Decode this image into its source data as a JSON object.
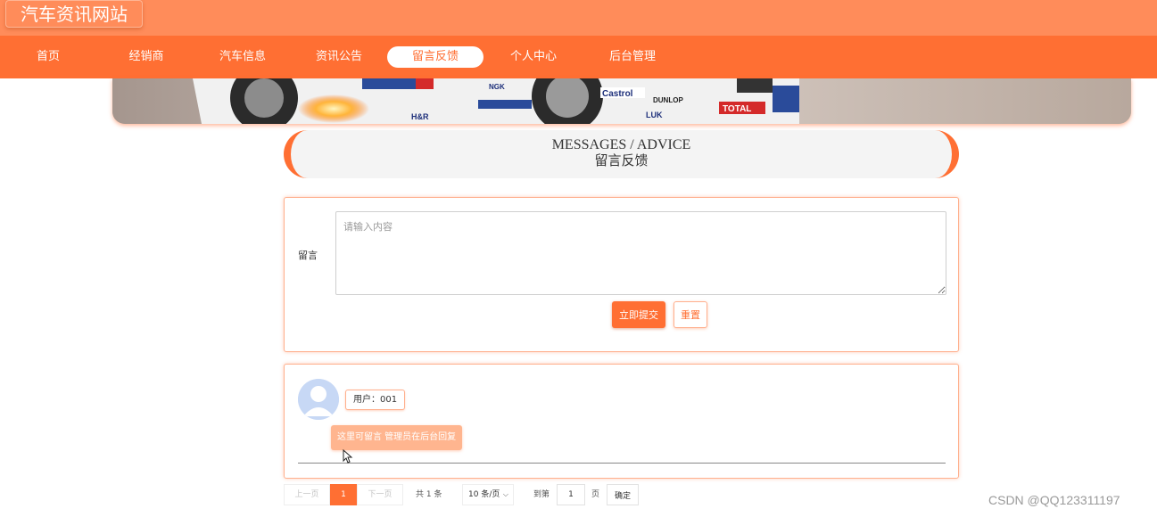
{
  "header": {
    "site_title": "汽车资讯网站"
  },
  "nav": {
    "items": [
      {
        "label": "首页"
      },
      {
        "label": "经销商"
      },
      {
        "label": "汽车信息"
      },
      {
        "label": "资讯公告"
      },
      {
        "label": "留言反馈",
        "active": true
      },
      {
        "label": "个人中心"
      },
      {
        "label": "后台管理"
      }
    ]
  },
  "banner": {
    "decals": [
      "Castrol",
      "DUNLOP",
      "TOTAL",
      "LUK",
      "H&R",
      "NGK"
    ]
  },
  "section": {
    "title_en": "MESSAGES / ADVICE",
    "title_cn": "留言反馈"
  },
  "form": {
    "label": "留言",
    "placeholder": "请输入内容",
    "value": "",
    "submit_label": "立即提交",
    "reset_label": "重置"
  },
  "comments": [
    {
      "user": "用户：001",
      "content": "这里可留言 管理员在后台回复"
    }
  ],
  "pagination": {
    "prev": "上一页",
    "current_page": "1",
    "next": "下一页",
    "total": "共 1 条",
    "page_size": "10 条/页",
    "goto_prefix": "到第",
    "goto_value": "1",
    "goto_suffix": "页",
    "confirm": "确定"
  },
  "watermark": "CSDN @QQ123311197",
  "colors": {
    "primary": "#ff6f33",
    "topbar": "#ff8c5a",
    "border": "#ffb08e"
  }
}
